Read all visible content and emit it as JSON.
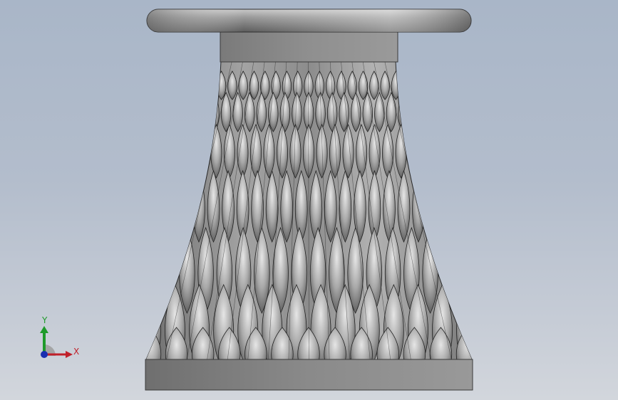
{
  "viewport": {
    "background_top": "#a9b6c8",
    "background_bottom": "#d2d6dc"
  },
  "model": {
    "name": "vase",
    "body_color": "#8d8d8d"
  },
  "triad": {
    "x_label": "X",
    "y_label": "Y",
    "x_color": "#c0202a",
    "y_color": "#1e9a2a",
    "z_color": "#1a2fb0"
  }
}
